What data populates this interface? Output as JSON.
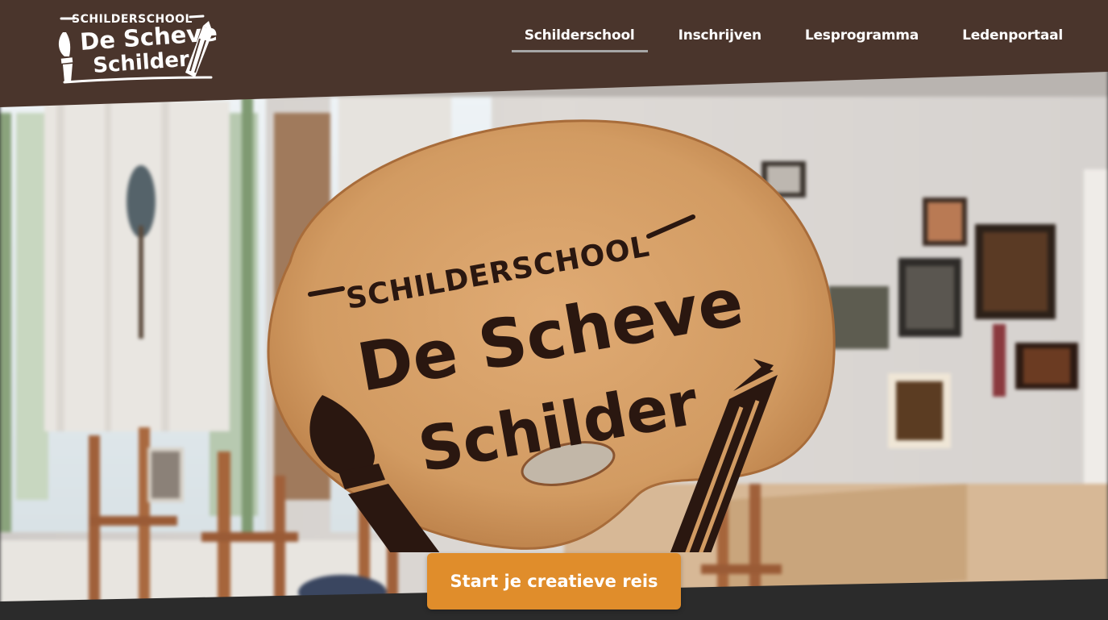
{
  "brand": {
    "line1": "SCHILDERSCHOOL",
    "line2": "De Scheve",
    "line3": "Schilder"
  },
  "nav": {
    "items": [
      {
        "label": "Schilderschool",
        "active": true
      },
      {
        "label": "Inschrijven",
        "active": false
      },
      {
        "label": "Lesprogramma",
        "active": false
      },
      {
        "label": "Ledenportaal",
        "active": false
      }
    ]
  },
  "hero": {
    "sign_line1": "SCHILDERSCHOOL",
    "sign_line2": "De Scheve",
    "sign_line3": "Schilder",
    "cta_label": "Start je creatieve reis"
  },
  "colors": {
    "header_bg": "#4a352c",
    "cta_bg": "#e08d2b",
    "wood": "#d39a63",
    "burn": "#2a1710"
  }
}
